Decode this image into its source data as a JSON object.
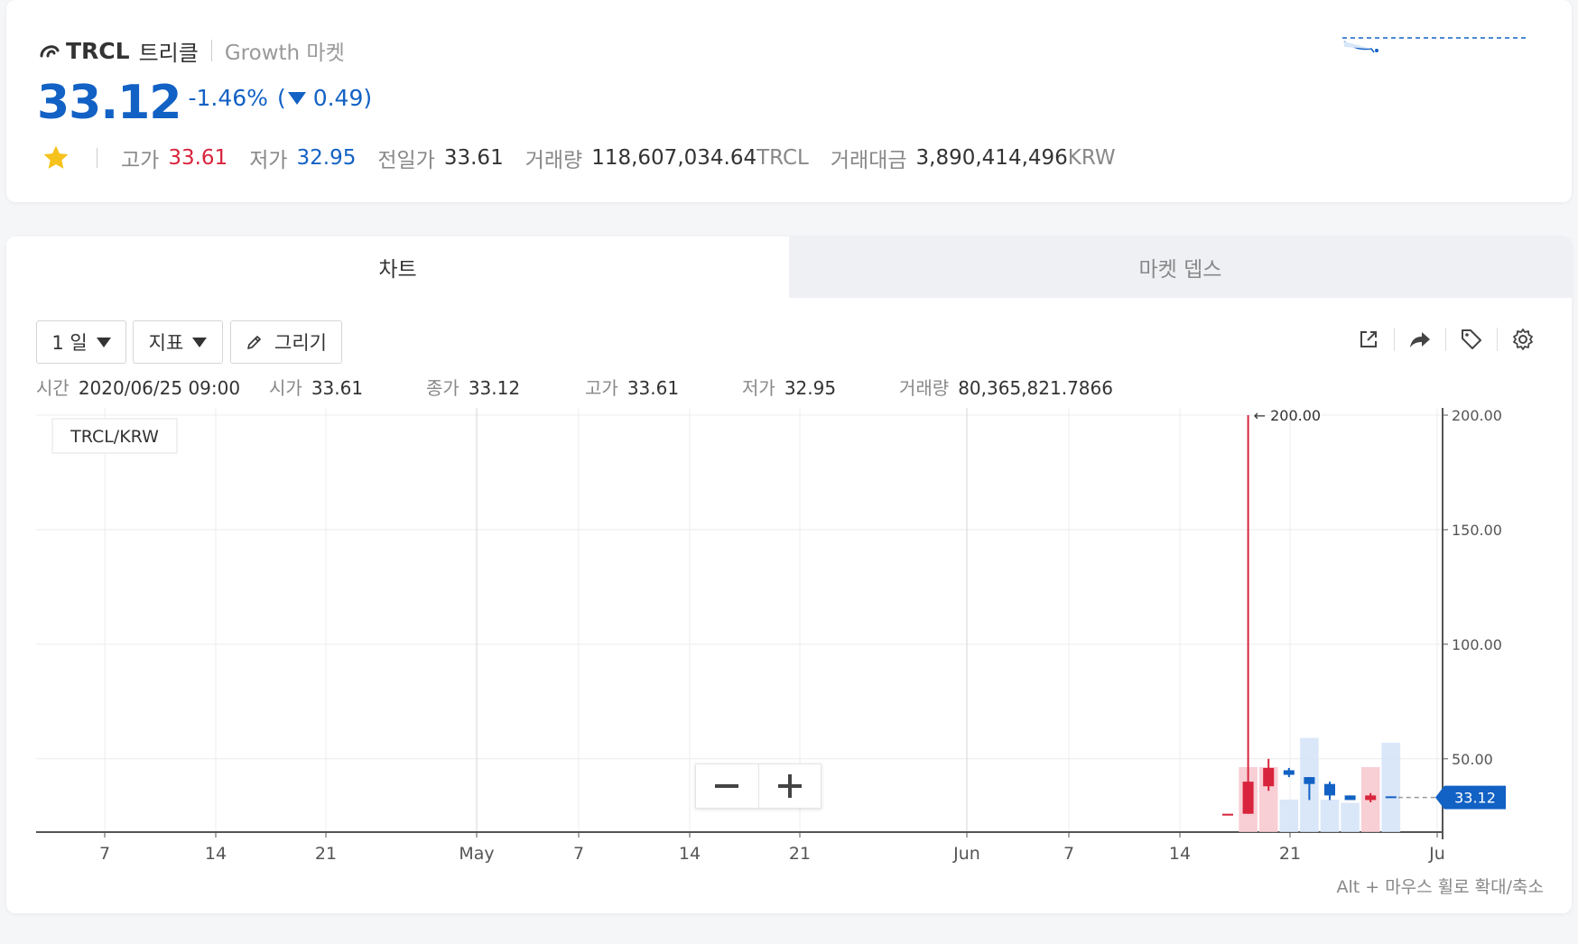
{
  "summary": {
    "symbol": "TRCL",
    "korean_name": "트리클",
    "market": "Growth 마켓",
    "price": "33.12",
    "change_pct": "-1.46%",
    "change_open": "(",
    "change_abs": "0.49)",
    "favorite_icon": "star-icon",
    "high_label": "고가",
    "high_value": "33.61",
    "low_label": "저가",
    "low_value": "32.95",
    "prev_label": "전일가",
    "prev_value": "33.61",
    "volume_label": "거래량",
    "volume_value": "118,607,034.64",
    "volume_unit": "TRCL",
    "amount_label": "거래대금",
    "amount_value": "3,890,414,496",
    "amount_unit": "KRW",
    "colors": {
      "up": "#d8243c",
      "down": "#1261c4"
    }
  },
  "tabs": [
    {
      "label": "차트",
      "active": true
    },
    {
      "label": "마켓 뎁스",
      "active": false
    }
  ],
  "toolbar": {
    "interval": "1 일",
    "indicator": "지표",
    "draw": "그리기",
    "icons": [
      "external-link-icon",
      "share-icon",
      "tag-icon",
      "gear-icon"
    ]
  },
  "ohlc": {
    "time_label": "시간",
    "time_value": "2020/06/25 09:00",
    "open_label": "시가",
    "open_value": "33.61",
    "close_label": "종가",
    "close_value": "33.12",
    "high_label": "고가",
    "high_value": "33.61",
    "low_label": "저가",
    "low_value": "32.95",
    "vol_label": "거래량",
    "vol_value": "80,365,821.7866"
  },
  "chart_data": {
    "type": "candlestick",
    "pair_label": "TRCL/KRW",
    "x_ticks": [
      "7",
      "14",
      "21",
      "May",
      "7",
      "14",
      "21",
      "Jun",
      "7",
      "14",
      "21",
      "Ju"
    ],
    "y_ticks": [
      "200.00",
      "150.00",
      "100.00",
      "50.00"
    ],
    "y_tick_values": [
      200,
      150,
      100,
      50
    ],
    "ylim": [
      18,
      200
    ],
    "max_annotation": "← 200.00",
    "last_price_label": "33.12",
    "last_price": 33.12,
    "candles": [
      {
        "date": "2020-06-17",
        "open": 26,
        "high": 26,
        "low": 26,
        "close": 26,
        "volume": 0
      },
      {
        "date": "2020-06-18",
        "open": 26,
        "high": 200,
        "low": 26,
        "close": 40,
        "volume": 40
      },
      {
        "date": "2020-06-19",
        "open": 38,
        "high": 50,
        "low": 36,
        "close": 46,
        "volume": 40
      },
      {
        "date": "2020-06-20",
        "open": 45,
        "high": 46,
        "low": 42,
        "close": 43,
        "volume": 20
      },
      {
        "date": "2020-06-21",
        "open": 42,
        "high": 42,
        "low": 32,
        "close": 39,
        "volume": 58
      },
      {
        "date": "2020-06-22",
        "open": 39,
        "high": 40,
        "low": 32,
        "close": 34,
        "volume": 20
      },
      {
        "date": "2020-06-23",
        "open": 34,
        "high": 34,
        "low": 32,
        "close": 32,
        "volume": 18
      },
      {
        "date": "2020-06-24",
        "open": 32,
        "high": 35,
        "low": 31,
        "close": 34,
        "volume": 40
      },
      {
        "date": "2020-06-25",
        "open": 33.61,
        "high": 33.61,
        "low": 32.95,
        "close": 33.12,
        "volume": 55
      }
    ]
  },
  "zoom": {
    "minus_icon": "minus-icon",
    "plus_icon": "plus-icon"
  },
  "hint": "Alt + 마우스 휠로 확대/축소"
}
